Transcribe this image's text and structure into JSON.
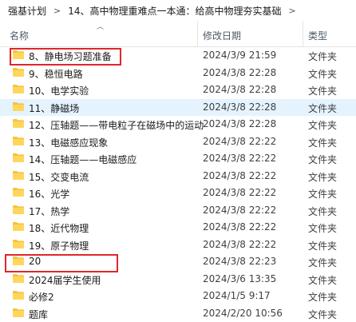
{
  "breadcrumb": {
    "items": [
      "强基计划",
      "14、高中物理重难点一本通：给高中物理夯实基础"
    ]
  },
  "columns": {
    "name": "名称",
    "date": "修改日期",
    "type": "类型"
  },
  "files": [
    {
      "name": "8、静电场习题准备",
      "date": "2024/3/9 21:59",
      "type": "文件夹"
    },
    {
      "name": "9、稳恒电路",
      "date": "2024/3/8 22:28",
      "type": "文件夹"
    },
    {
      "name": "10、电学实验",
      "date": "2024/3/8 22:28",
      "type": "文件夹"
    },
    {
      "name": "11、静磁场",
      "date": "2024/3/8 22:28",
      "type": "文件夹"
    },
    {
      "name": "12、压轴题——带电粒子在磁场中的运动",
      "date": "2024/3/8 22:28",
      "type": "文件夹"
    },
    {
      "name": "13、电磁感应现象",
      "date": "2024/3/8 22:22",
      "type": "文件夹"
    },
    {
      "name": "14、压轴题——电磁感应",
      "date": "2024/3/8 22:22",
      "type": "文件夹"
    },
    {
      "name": "15、交变电流",
      "date": "2024/3/8 22:22",
      "type": "文件夹"
    },
    {
      "name": "16、光学",
      "date": "2024/3/8 22:22",
      "type": "文件夹"
    },
    {
      "name": "17、热学",
      "date": "2024/3/8 22:22",
      "type": "文件夹"
    },
    {
      "name": "18、近代物理",
      "date": "2024/3/8 22:22",
      "type": "文件夹"
    },
    {
      "name": "19、原子物理",
      "date": "2024/3/8 22:22",
      "type": "文件夹"
    },
    {
      "name": "20",
      "date": "2024/3/8 22:23",
      "type": "文件夹"
    },
    {
      "name": "2024届学生使用",
      "date": "2024/3/6 13:35",
      "type": "文件夹"
    },
    {
      "name": "必修2",
      "date": "2024/1/5 9:17",
      "type": "文件夹"
    },
    {
      "name": "题库",
      "date": "2024/2/20 10:56",
      "type": "文件夹"
    }
  ],
  "colors": {
    "folder": "#f5c33b",
    "highlight": "#e0262b",
    "selected_row": "#cce8ff",
    "hover_row": "#e5f3ff"
  },
  "icons": {
    "folder": "folder-icon",
    "sort": "sort-up-icon",
    "separator": "chevron-right-icon"
  }
}
